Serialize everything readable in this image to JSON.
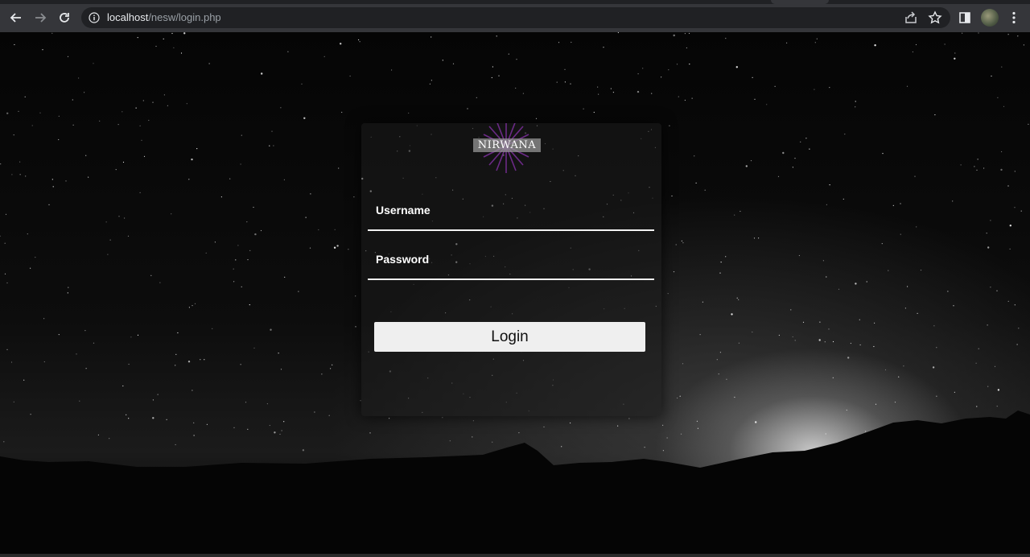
{
  "browser": {
    "url_host": "localhost",
    "url_path": "/nesw/login.php"
  },
  "logo": {
    "text": "NIRWANA",
    "ray_color": "#6b2a86"
  },
  "form": {
    "username_label": "Username",
    "password_label": "Password",
    "login_label": "Login"
  },
  "icons": {
    "back": "back-arrow-icon",
    "forward": "forward-arrow-icon",
    "reload": "reload-icon",
    "info": "site-info-icon",
    "share": "share-icon",
    "bookmark": "star-icon",
    "side_panel": "side-panel-icon",
    "profile": "profile-avatar",
    "menu": "kebab-menu-icon"
  },
  "colors": {
    "browser_chrome": "#35363a",
    "omnibox": "#202124",
    "button_bg": "#efefef",
    "underline": "#f2f2f2"
  }
}
